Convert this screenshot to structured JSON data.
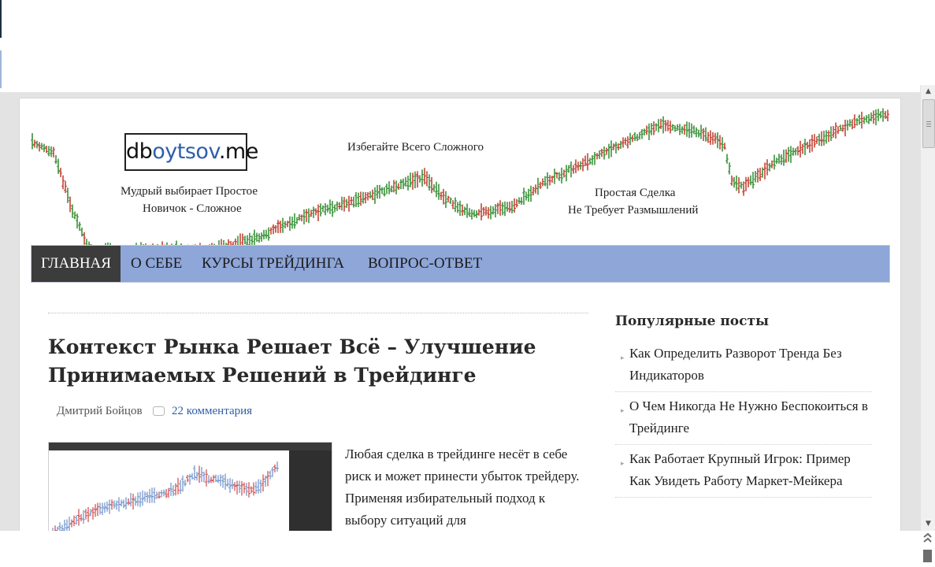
{
  "header": {
    "logo": {
      "part1": "db",
      "part2": "oytsov",
      "part3": ".me"
    },
    "slogan_center": "Избегайте Всего Сложного",
    "slogan_left_1": "Мудрый выбирает Простое",
    "slogan_left_2": "Новичок - Сложное",
    "slogan_right_1": "Простая Сделка",
    "slogan_right_2": "Не Требует Размышлений"
  },
  "nav": {
    "items": [
      {
        "label": "ГЛАВНАЯ",
        "active": true
      },
      {
        "label": "О СЕБЕ"
      },
      {
        "label": "КУРСЫ ТРЕЙДИНГА"
      },
      {
        "label": "ВОПРОС-ОТВЕТ"
      }
    ]
  },
  "post": {
    "title": "Контекст Рынка Решает Всё – Улучшение Принимаемых Решений в Трейдинге",
    "author": "Дмитрий Бойцов",
    "comments": "22 комментария",
    "excerpt": "Любая сделка в трейдинге несёт в себе риск и может принести убыток трейдеру. Применяя избирательный подход к выбору ситуаций для"
  },
  "sidebar": {
    "title": "Популярные посты",
    "items": [
      "Как Определить Разворот Тренда Без Индикаторов",
      "О Чем Никогда Не Нужно Беспокоиться в Трейдинге",
      "Как Работает Крупный Игрок: Пример Как Увидеть Работу Маркет-Мейкера"
    ]
  },
  "colors": {
    "nav_background": "#8ea6d8",
    "nav_active": "#3c3c3c",
    "bar_up": "#2e8b2e",
    "bar_down": "#c0392b",
    "link": "#2f5fa8"
  },
  "icons": {
    "comment": "comment-icon",
    "bullet": "triangle-right-icon",
    "scroll_up": "arrow-up-icon",
    "scroll_down": "arrow-down-icon"
  }
}
